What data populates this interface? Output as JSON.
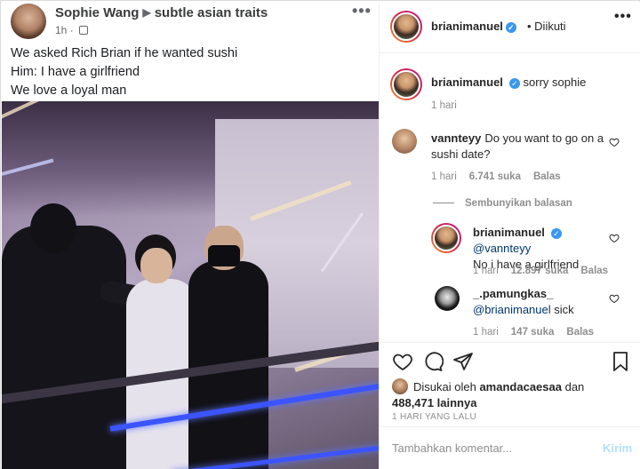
{
  "facebook_post": {
    "author": "Sophie Wang",
    "arrow": "▶",
    "group": "subtle asian traits",
    "time": "1h",
    "more": "•••",
    "lines": [
      "We asked Rich Brian if he wanted sushi",
      "Him: I have a girlfriend",
      "We love a loyal man"
    ]
  },
  "instagram": {
    "header": {
      "username": "brianimanuel",
      "verified_mark": "✓",
      "follow_status": "• Diikuti",
      "more": "•••"
    },
    "caption": {
      "username": "brianimanuel",
      "text": "sorry sophie",
      "time": "1 hari"
    },
    "comments": [
      {
        "username": "vannteyy",
        "text": "Do you want to go on a sushi date?",
        "time": "1 hari",
        "likes": "6.741 suka",
        "reply": "Balas"
      }
    ],
    "hide_replies": "Sembunyikan balasan",
    "replies": [
      {
        "username": "brianimanuel",
        "mention": "@vannteyy",
        "text": "No i have a girlfriend",
        "time": "1 hari",
        "likes": "12.897 suka",
        "reply": "Balas"
      },
      {
        "username": "_.pamungkas_",
        "mention": "@brianimanuel",
        "text": "sick",
        "time": "1 hari",
        "likes": "147 suka",
        "reply": "Balas"
      }
    ],
    "liked_by": {
      "prefix": "Disukai oleh",
      "user": "amandacaesaa",
      "conj": "dan",
      "count": "488,471",
      "suffix": "lainnya"
    },
    "date": "1 HARI YANG LALU",
    "comment_box": {
      "placeholder": "Tambahkan komentar...",
      "send": "Kirim"
    },
    "accent": "#3897f0"
  }
}
